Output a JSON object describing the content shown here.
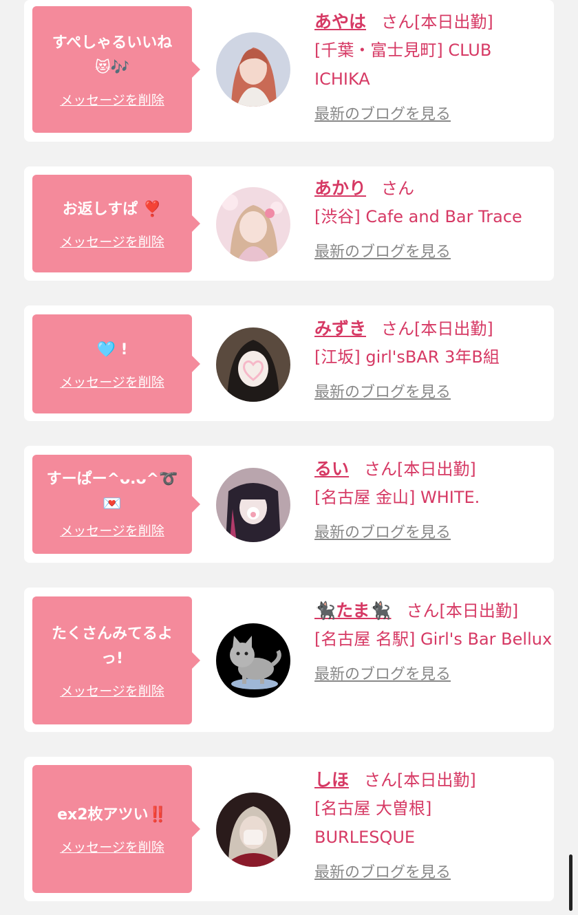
{
  "items": [
    {
      "message": "すぺしゃるいいね\n😻🎶",
      "delete_label": "メッセージを削除",
      "name": "あやは",
      "san": "さん",
      "status": "[本日出勤]",
      "shop": "[千葉・富士見町] CLUB ICHIKA",
      "blog_label": "最新のブログを見る"
    },
    {
      "message": "お返しすぱ ❣️",
      "delete_label": "メッセージを削除",
      "name": "あかり",
      "san": "さん",
      "status": "",
      "shop": "[渋谷] Cafe and Bar Trace",
      "blog_label": "最新のブログを見る"
    },
    {
      "message": "🩵 !",
      "delete_label": "メッセージを削除",
      "name": "みずき",
      "san": "さん",
      "status": "[本日出勤]",
      "shop": "[江坂] girl'sBAR 3年B組",
      "blog_label": "最新のブログを見る"
    },
    {
      "message": "すーぱー^ᴗ.ᴗ^➰\n💌",
      "delete_label": "メッセージを削除",
      "name": "るい",
      "san": "さん",
      "status": "[本日出勤]",
      "shop": "[名古屋 金山] WHITE.",
      "blog_label": "最新のブログを見る"
    },
    {
      "message": "たくさんみてるよ\nっ!",
      "delete_label": "メッセージを削除",
      "name": "🐈‍⬛たま🐈‍⬛",
      "san": "さん",
      "status": "[本日出勤]",
      "shop": "[名古屋 名駅] Girl's Bar Bellux",
      "blog_label": "最新のブログを見る"
    },
    {
      "message": "ex2枚アツい‼️",
      "delete_label": "メッセージを削除",
      "name": "しほ",
      "san": "さん",
      "status": "[本日出勤]",
      "shop": "[名古屋 大曽根] BURLESQUE",
      "blog_label": "最新のブログを見る"
    }
  ],
  "colors": {
    "bubble": "#f48a9b",
    "accent": "#d63964",
    "muted": "#888888",
    "background": "#f2f2f2"
  },
  "icons": [
    "avatar-photo",
    "scrollbar"
  ]
}
